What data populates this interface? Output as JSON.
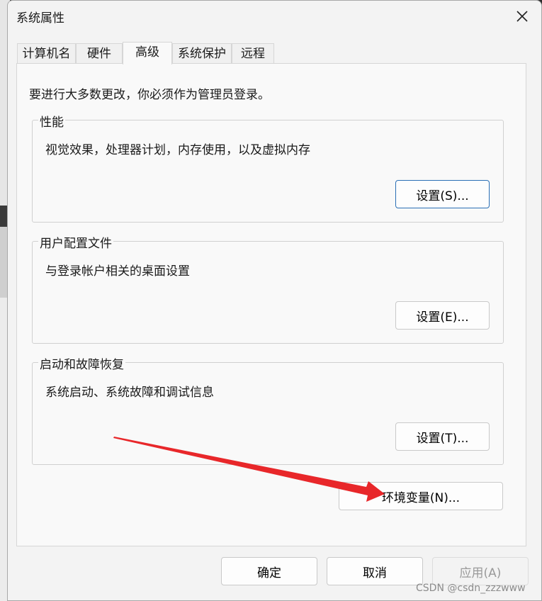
{
  "window": {
    "title": "系统属性"
  },
  "tabs": [
    {
      "label": "计算机名",
      "active": false
    },
    {
      "label": "硬件",
      "active": false
    },
    {
      "label": "高级",
      "active": true
    },
    {
      "label": "系统保护",
      "active": false
    },
    {
      "label": "远程",
      "active": false
    }
  ],
  "intro": "要进行大多数更改，你必须作为管理员登录。",
  "groups": {
    "performance": {
      "title": "性能",
      "description": "视觉效果，处理器计划，内存使用，以及虚拟内存",
      "button": "设置(S)..."
    },
    "profiles": {
      "title": "用户配置文件",
      "description": "与登录帐户相关的桌面设置",
      "button": "设置(E)..."
    },
    "startup": {
      "title": "启动和故障恢复",
      "description": "系统启动、系统故障和调试信息",
      "button": "设置(T)..."
    }
  },
  "env_button": "环境变量(N)...",
  "footer": {
    "ok": "确定",
    "cancel": "取消",
    "apply": "应用(A)"
  },
  "watermark": "CSDN @csdn_zzzwww",
  "colors": {
    "default_button_border": "#2a6fb5",
    "arrow": "#e8272a"
  }
}
